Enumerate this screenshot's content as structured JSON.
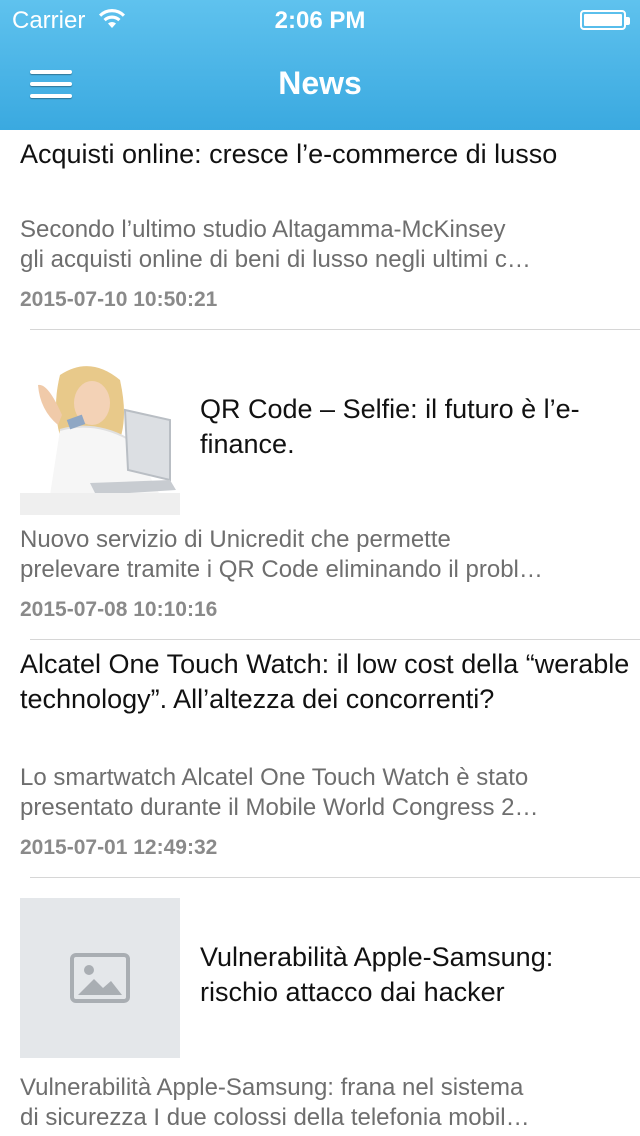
{
  "status_bar": {
    "carrier": "Carrier",
    "time": "2:06 PM"
  },
  "navbar": {
    "title": "News",
    "menu_icon": "hamburger-menu-icon"
  },
  "news": [
    {
      "title": "Acquisti online: cresce l’e-commerce di lusso",
      "summary_line1": "Secondo l’ultimo studio Altagamma-McKinsey",
      "summary_line2": "gli acquisti online di beni di lusso negli ultimi c…",
      "date": "2015-07-10 10:50:21"
    },
    {
      "title": "QR Code – Selfie: il futuro è l’e-finance.",
      "image": "woman-with-laptop-photo",
      "summary_line1": "Nuovo servizio di Unicredit che permette",
      "summary_line2": "prelevare tramite i QR Code eliminando il probl…",
      "date": "2015-07-08 10:10:16"
    },
    {
      "title": "Alcatel One Touch Watch: il low cost della “werable technology”. All’altezza dei concorrenti?",
      "summary_line1": "Lo smartwatch Alcatel One Touch Watch è stato",
      "summary_line2": "presentato durante il Mobile World Congress 2…",
      "date": "2015-07-01 12:49:32"
    },
    {
      "title": "Vulnerabilità Apple-Samsung: rischio attacco dai hacker",
      "image": "image-placeholder-icon",
      "summary_line1": "Vulnerabilità Apple-Samsung: frana nel sistema",
      "summary_line2": "di sicurezza I due colossi della telefonia mobil…"
    }
  ],
  "colors": {
    "header": "#3aa9e0",
    "title_text": "#111111",
    "summary_text": "#6e6e6e",
    "date_text": "#8a8a8a"
  }
}
